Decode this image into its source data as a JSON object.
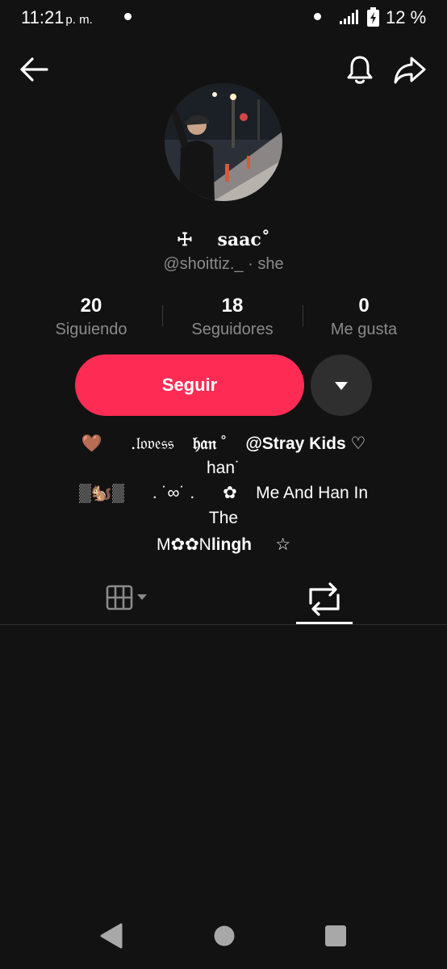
{
  "status_bar": {
    "time": "11:21",
    "ampm": "p. m.",
    "battery": "12 %"
  },
  "profile": {
    "display_name": "☩    saac˚",
    "username": "@shoittiz._ · she",
    "avatar_icon": "profile-photo"
  },
  "stats": [
    {
      "value": "20",
      "label": "Siguiendo"
    },
    {
      "value": "18",
      "label": "Seguidores"
    },
    {
      "value": "0",
      "label": "Me gusta"
    }
  ],
  "actions": {
    "follow_label": "Seguir",
    "more_icon": "caret-down-icon"
  },
  "bio": {
    "line1_emoji": "🤎",
    "line1_lovess": ".𝔩𝔬𝔳𝔢𝔰𝔰",
    "line1_han": "𝔥𝔞𝔫",
    "line1_deg": "˚",
    "line1_mention": "@Stray Kids",
    "line1_heart": "♡",
    "line2": "han˙",
    "line3_art": "▒🐿️▒",
    "line3_mid": ". ˙∞˙ .",
    "line3_flower": "✿",
    "line3_text": "Me And Han In",
    "line4": "The",
    "line5_a": "M✿✿N",
    "line5_b": "lingh",
    "line5_star": "☆"
  },
  "tabs": {
    "grid_icon": "grid-icon",
    "repost_icon": "repost-icon",
    "active": "repost"
  },
  "colors": {
    "background": "#121212",
    "accent": "#fe2c55",
    "secondary_text": "#8a8a8a"
  }
}
